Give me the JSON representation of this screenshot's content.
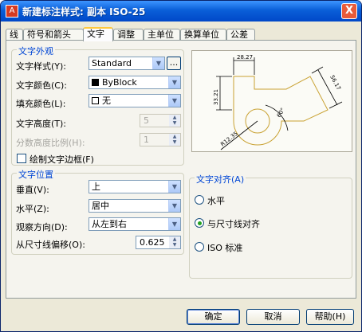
{
  "window": {
    "title": "新建标注样式: 副本 ISO-25",
    "close_symbol": "X",
    "icon_text": "A"
  },
  "tabs": [
    "线",
    "符号和箭头",
    "文字",
    "调整",
    "主单位",
    "换算单位",
    "公差"
  ],
  "text_appearance": {
    "group_title": "文字外观",
    "style_label": "文字样式(Y):",
    "style_value": "Standard",
    "style_button": "...",
    "color_label": "文字颜色(C):",
    "color_value": "ByBlock",
    "fill_label": "填充颜色(L):",
    "fill_value": "无",
    "height_label": "文字高度(T):",
    "height_value": "5",
    "fraction_label": "分数高度比例(H):",
    "fraction_value": "1",
    "frame_label": "绘制文字边框(F)"
  },
  "text_placement": {
    "group_title": "文字位置",
    "vertical_label": "垂直(V):",
    "vertical_value": "上",
    "horizontal_label": "水平(Z):",
    "horizontal_value": "居中",
    "view_label": "观察方向(D):",
    "view_value": "从左到右",
    "offset_label": "从尺寸线偏移(O):",
    "offset_value": "0.625"
  },
  "text_alignment": {
    "group_title": "文字对齐(A)",
    "options": [
      "水平",
      "与尺寸线对齐",
      "ISO 标准"
    ],
    "selected": 1
  },
  "preview": {
    "dim1": "28.27",
    "dim2": "33.21",
    "dim3": "56.17",
    "angle": "60°",
    "radius": "R12.35"
  },
  "buttons": {
    "ok": "确定",
    "cancel": "取消",
    "help": "帮助(H)"
  }
}
